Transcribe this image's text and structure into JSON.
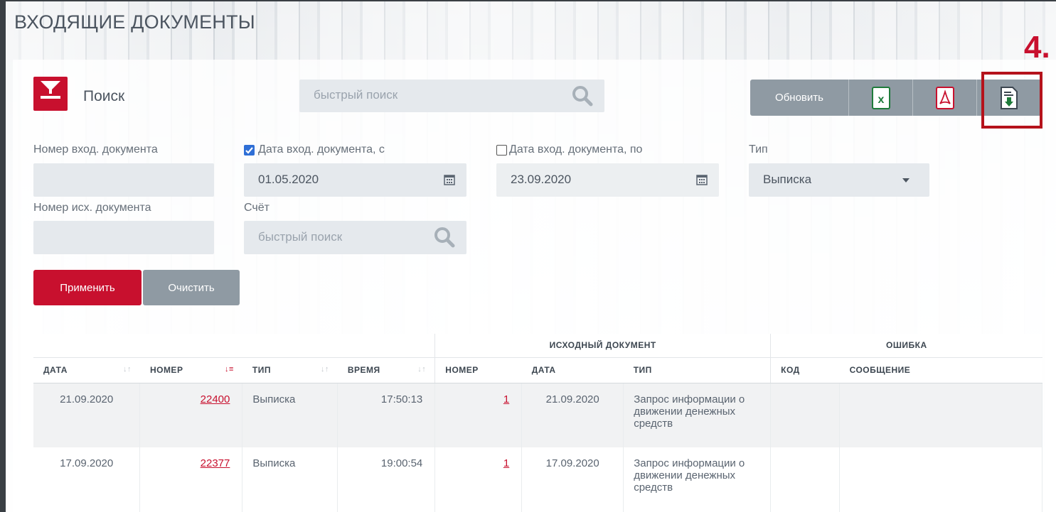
{
  "page": {
    "title": "ВХОДЯЩИЕ ДОКУМЕНТЫ"
  },
  "annotation": {
    "number": "4."
  },
  "search": {
    "label": "Поиск",
    "quick_placeholder": "быстрый поиск"
  },
  "toolbar": {
    "refresh_label": "Обновить",
    "excel_icon": "excel-icon",
    "pdf_icon": "pdf-icon",
    "download_icon": "download-document-icon"
  },
  "filters": {
    "in_number_label": "Номер вход. документа",
    "in_number_value": "",
    "date_from_label": "Дата вход. документа, с",
    "date_from_checked": true,
    "date_from_value": "01.05.2020",
    "date_to_label": "Дата вход. документа, по",
    "date_to_checked": false,
    "date_to_value": "23.09.2020",
    "type_label": "Тип",
    "type_value": "Выписка",
    "out_number_label": "Номер исх. документа",
    "out_number_value": "",
    "account_label": "Счёт",
    "account_placeholder": "быстрый поиск"
  },
  "buttons": {
    "apply": "Применить",
    "clear": "Очистить"
  },
  "table": {
    "group_source": "ИСХОДНЫЙ ДОКУМЕНТ",
    "group_error": "ОШИБКА",
    "columns": [
      "ДАТА",
      "НОМЕР",
      "ТИП",
      "ВРЕМЯ",
      "НОМЕР",
      "ДАТА",
      "ТИП",
      "КОД",
      "СООБЩЕНИЕ"
    ],
    "rows": [
      {
        "date": "21.09.2020",
        "number": "22400",
        "type": "Выписка",
        "time": "17:50:13",
        "src_number": "1",
        "src_date": "21.09.2020",
        "src_type": "Запрос информации о движении денежных средств",
        "err_code": "",
        "err_msg": ""
      },
      {
        "date": "17.09.2020",
        "number": "22377",
        "type": "Выписка",
        "time": "19:00:54",
        "src_number": "1",
        "src_date": "17.09.2020",
        "src_type": "Запрос информации о движении денежных средств",
        "err_code": "",
        "err_msg": ""
      }
    ]
  },
  "colors": {
    "accent": "#c8102e",
    "secondary": "#8f9aa3",
    "input_bg": "#e5e9ed",
    "checkbox": "#2f6fd6"
  }
}
